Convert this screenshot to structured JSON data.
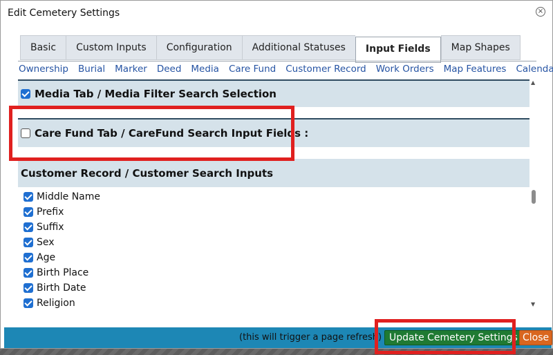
{
  "dialog": {
    "title": "Edit Cemetery Settings",
    "close_glyph": "×"
  },
  "tabs": [
    {
      "label": "Basic",
      "active": false
    },
    {
      "label": "Custom Inputs",
      "active": false
    },
    {
      "label": "Configuration",
      "active": false
    },
    {
      "label": "Additional Statuses",
      "active": false
    },
    {
      "label": "Input Fields",
      "active": true
    },
    {
      "label": "Map Shapes",
      "active": false
    }
  ],
  "subnav": [
    "Ownership",
    "Burial",
    "Marker",
    "Deed",
    "Media",
    "Care Fund",
    "Customer Record",
    "Work Orders",
    "Map Features",
    "Calendar"
  ],
  "sections": {
    "media": {
      "label": "Media Tab / Media Filter Search Selection",
      "checked": true
    },
    "carefund": {
      "label": "Care Fund Tab / CareFund Search Input Fields :",
      "checked": false
    },
    "customer": {
      "label": "Customer Record / Customer Search Inputs"
    }
  },
  "customer_fields": [
    {
      "label": "Middle Name",
      "checked": true
    },
    {
      "label": "Prefix",
      "checked": true
    },
    {
      "label": "Suffix",
      "checked": true
    },
    {
      "label": "Sex",
      "checked": true
    },
    {
      "label": "Age",
      "checked": true
    },
    {
      "label": "Birth Place",
      "checked": true
    },
    {
      "label": "Birth Date",
      "checked": true
    },
    {
      "label": "Religion",
      "checked": true
    }
  ],
  "footer": {
    "note": "(this will trigger a page refresh)",
    "update_label": "Update Cemetery Settings",
    "close_label": "Close"
  },
  "colors": {
    "footer_bg": "#1d87b5",
    "update_btn": "#1f7a33",
    "close_btn": "#d9661f",
    "highlight": "#e0201f",
    "section_bg": "#d5e2ea",
    "checkbox": "#1f6fd1"
  }
}
